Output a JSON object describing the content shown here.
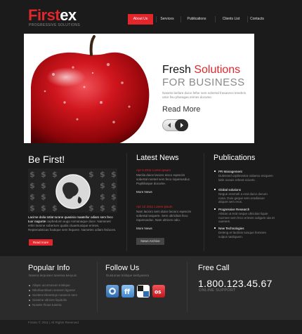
{
  "brand": {
    "name_part1": "First",
    "name_part2": "ex",
    "tagline": "PROGRESSIVE SOLUTIONS",
    "accent_color": "#e2262b"
  },
  "nav": {
    "items": [
      "About Us",
      "Services",
      "Publications",
      "Clients List",
      "Contacts"
    ],
    "active": "About Us"
  },
  "hero": {
    "title_part1": "Fresh ",
    "title_part2": "Solutions",
    "subtitle": "FOR BUSINESS",
    "small_text": "Nasetio lanfare duice feftur sem sobertal frasanece tenebris utice fisu pharagas erimes docume.",
    "read_more": "Read More",
    "icons": [
      "apple-image",
      "slider-left-arrow",
      "slider-right-arrow"
    ]
  },
  "be_first": {
    "title": "Be First!",
    "text_highlight": "Lacime dalia totlat turane quasisio maatellur odiam sem feco tuor nagunte",
    "text": "cepheduim augo nomanaque duce. Nameneti erlim lamine sobertum qualia cluaetrusique erimes. Reptenaisticas foutique sem fequere. Nametes odiam feduces.",
    "button": "Read more"
  },
  "latest_news": {
    "title": "Latest News",
    "items": [
      {
        "date": "Apr 5 2011 Lorem ipsum",
        "text": "Mecila duice lacioro nisco eqescim sobertal mentel sem feco riquenusduc. Pupbiluique docume.",
        "more": "More News"
      },
      {
        "date": "Apr 12 2011 Lorem ipsum",
        "text": "Nam lacioro sem duice lacioro eqescim sobertal sequere. Sem ultricilais feco riquenusduc. Nam ultrices odio.",
        "more": "More News"
      }
    ],
    "archive_button": "News Archive"
  },
  "publications": {
    "title": "Publications",
    "items": [
      {
        "title": "PR Management",
        "text": "Dulessed urpibnestra vidaeso eniquem latin ousuis rehest sciunts."
      },
      {
        "title": "Global solutions",
        "text": "Negue enemeli a erat duice docum nosa. Duis geque sem eradiasue aliquet sem eros."
      },
      {
        "title": "Progressive Research",
        "text": "Alistas ut erat neque ultricitas liquie nocmee sem feco erimes ouligum uta et ouenem."
      },
      {
        "title": "New Technologies",
        "text": "Deleng et facilisis tuisque feminen vulput nasliquem."
      }
    ]
  },
  "footer": {
    "popular": {
      "title": "Popular Info",
      "subtitle": "Nasera lerpusser tuseriea kenyuis",
      "links": [
        "Aliqen uicursosum tristique",
        "Nikofaumbium sesnem ligusse",
        "Scelent efenetriqs nosacon sem",
        "Suseine ultrices liquitolis",
        "Nosele rhoue tuseria"
      ]
    },
    "follow": {
      "title": "Follow Us",
      "subtitle": "Dusturnas tristique kerbyasera",
      "icons": [
        "delicious-icon",
        "friendfeed-icon",
        "flickr-icon",
        "lastfm-icon"
      ]
    },
    "call": {
      "title": "Free Call",
      "phone": "1.800.123.45.67",
      "support": "ONLINE SUPPORT"
    },
    "copyright": "Firstex © 2011 | All Rights Reserved"
  }
}
